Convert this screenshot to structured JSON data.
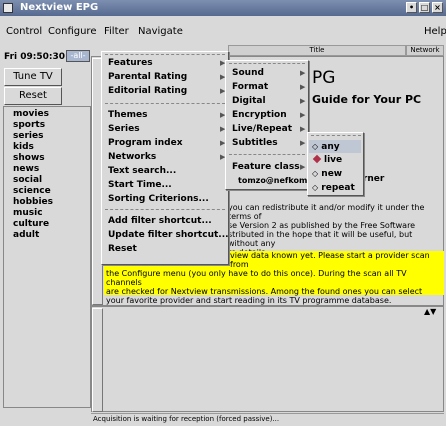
{
  "window": {
    "title": "Nextview EPG",
    "buttons": [
      "•",
      "□",
      "×"
    ]
  },
  "menubar": {
    "items": [
      "Control",
      "Configure",
      "Filter",
      "Navigate"
    ],
    "help": "Help"
  },
  "date_button": "Fri 09:50:30",
  "all_button": "-all-",
  "sidebar": {
    "tune_tv": "Tune TV",
    "reset": "Reset",
    "themes": [
      "movies",
      "sports",
      "series",
      "kids",
      "shows",
      "news",
      "social",
      "science",
      "hobbies",
      "music",
      "culture",
      "adult"
    ]
  },
  "columns": {
    "title": "Title",
    "network": "Network"
  },
  "content": {
    "big_fragment": "PG",
    "guide_fragment": "Guide for Your PC",
    "author_fragment": "Zürner",
    "license_lines": [
      "you can redistribute it and/or modify it under the terms of",
      "se Version 2 as published by the Free Software",
      "stributed in the hope that it will be useful, but without any",
      "re details."
    ],
    "warning_lines": [
      "view data known yet. Please start a provider scan from",
      "the Configure menu (you only have to do this once). During the scan all TV channels",
      "are checked for Nextview transmissions. Among the found ones you can select",
      "your favorite provider and start reading in its TV programme database."
    ]
  },
  "status": "Acquisition is waiting for reception (forced passive)...",
  "filter_menu": {
    "items": [
      "Features",
      "Parental Rating",
      "Editorial Rating",
      "Themes",
      "Series",
      "Program index",
      "Networks",
      "Text search...",
      "Start Time...",
      "Sorting Criterions...",
      "Add filter shortcut...",
      "Update filter shortcut...",
      "Reset"
    ]
  },
  "features_menu": {
    "items": [
      "Sound",
      "Format",
      "Digital",
      "Encryption",
      "Live/Repeat",
      "Subtitles",
      "Feature class"
    ],
    "feature_email": "tomzo@nefkom.n"
  },
  "live_menu": {
    "items": [
      "any",
      "live",
      "new",
      "repeat"
    ],
    "selected": "live"
  },
  "colors": {
    "title_bar": "#5f7196",
    "selection": "#bfc6d4",
    "warning_bg": "#ffff00",
    "checked": "#b03048"
  }
}
